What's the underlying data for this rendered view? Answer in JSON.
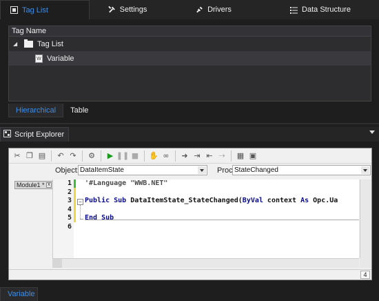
{
  "top_tabs": [
    {
      "label": "Tag List",
      "icon": "tag-list-icon"
    },
    {
      "label": "Settings",
      "icon": "wrench-icon"
    },
    {
      "label": "Drivers",
      "icon": "plug-icon"
    },
    {
      "label": "Data Structure",
      "icon": "list-icon"
    }
  ],
  "tag_panel": {
    "column_header": "Tag Name",
    "tree": [
      {
        "label": "Tag List",
        "icon": "folder-icon",
        "expanded": true
      },
      {
        "label": "Variable",
        "icon": "variable-icon",
        "icon_letter": "W"
      }
    ]
  },
  "view_tabs": [
    "Hierarchical",
    "Table"
  ],
  "script_explorer": {
    "title": "Script Explorer"
  },
  "editor": {
    "object_label": "Object:",
    "object_value": "DataItemState",
    "proc_label": "Proc:",
    "proc_value": "StateChanged",
    "module_tab": "Module1 *",
    "module_close": "x",
    "line_numbers": [
      "1",
      "2",
      "3",
      "4",
      "5",
      "6"
    ],
    "code": {
      "line1_comment": "'#Language \"WWB.NET\"",
      "line3_kw1": "Public Sub ",
      "line3_name": "DataItemState_StateChanged(",
      "line3_kw2": "ByVal",
      "line3_mid": " context ",
      "line3_kw3": "As",
      "line3_rest": " Opc.Ua",
      "line5_kw": "End Sub"
    },
    "status_value": "4"
  },
  "bottom_tab": "Variable",
  "colors": {
    "accent": "#3d8ee8",
    "background": "#1e1e1e",
    "green_marker": "#3bbf3b",
    "yellow_marker": "#f1d93c"
  }
}
